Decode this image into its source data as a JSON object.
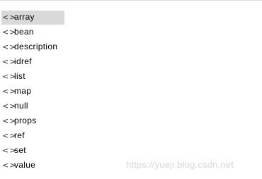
{
  "list": {
    "items": [
      {
        "icon": "angle-brackets-icon",
        "glyph": "<>",
        "label": "array",
        "selected": true
      },
      {
        "icon": "angle-brackets-icon",
        "glyph": "<>",
        "label": "bean"
      },
      {
        "icon": "angle-brackets-icon",
        "glyph": "<>",
        "label": "description"
      },
      {
        "icon": "angle-brackets-icon",
        "glyph": "<>",
        "label": "idref"
      },
      {
        "icon": "angle-brackets-icon",
        "glyph": "<>",
        "label": "list"
      },
      {
        "icon": "angle-brackets-icon",
        "glyph": "<>",
        "label": "map"
      },
      {
        "icon": "angle-brackets-icon",
        "glyph": "<>",
        "label": "null"
      },
      {
        "icon": "angle-brackets-icon",
        "glyph": "<>",
        "label": "props"
      },
      {
        "icon": "angle-brackets-icon",
        "glyph": "<>",
        "label": "ref"
      },
      {
        "icon": "angle-brackets-icon",
        "glyph": "<>",
        "label": "set"
      },
      {
        "icon": "angle-brackets-icon",
        "glyph": "<>",
        "label": "value"
      }
    ]
  },
  "watermark": "https://yueji.blog.csdn.net",
  "colors": {
    "selection": "#d9d9d9",
    "watermark": "#d6d6d6"
  }
}
